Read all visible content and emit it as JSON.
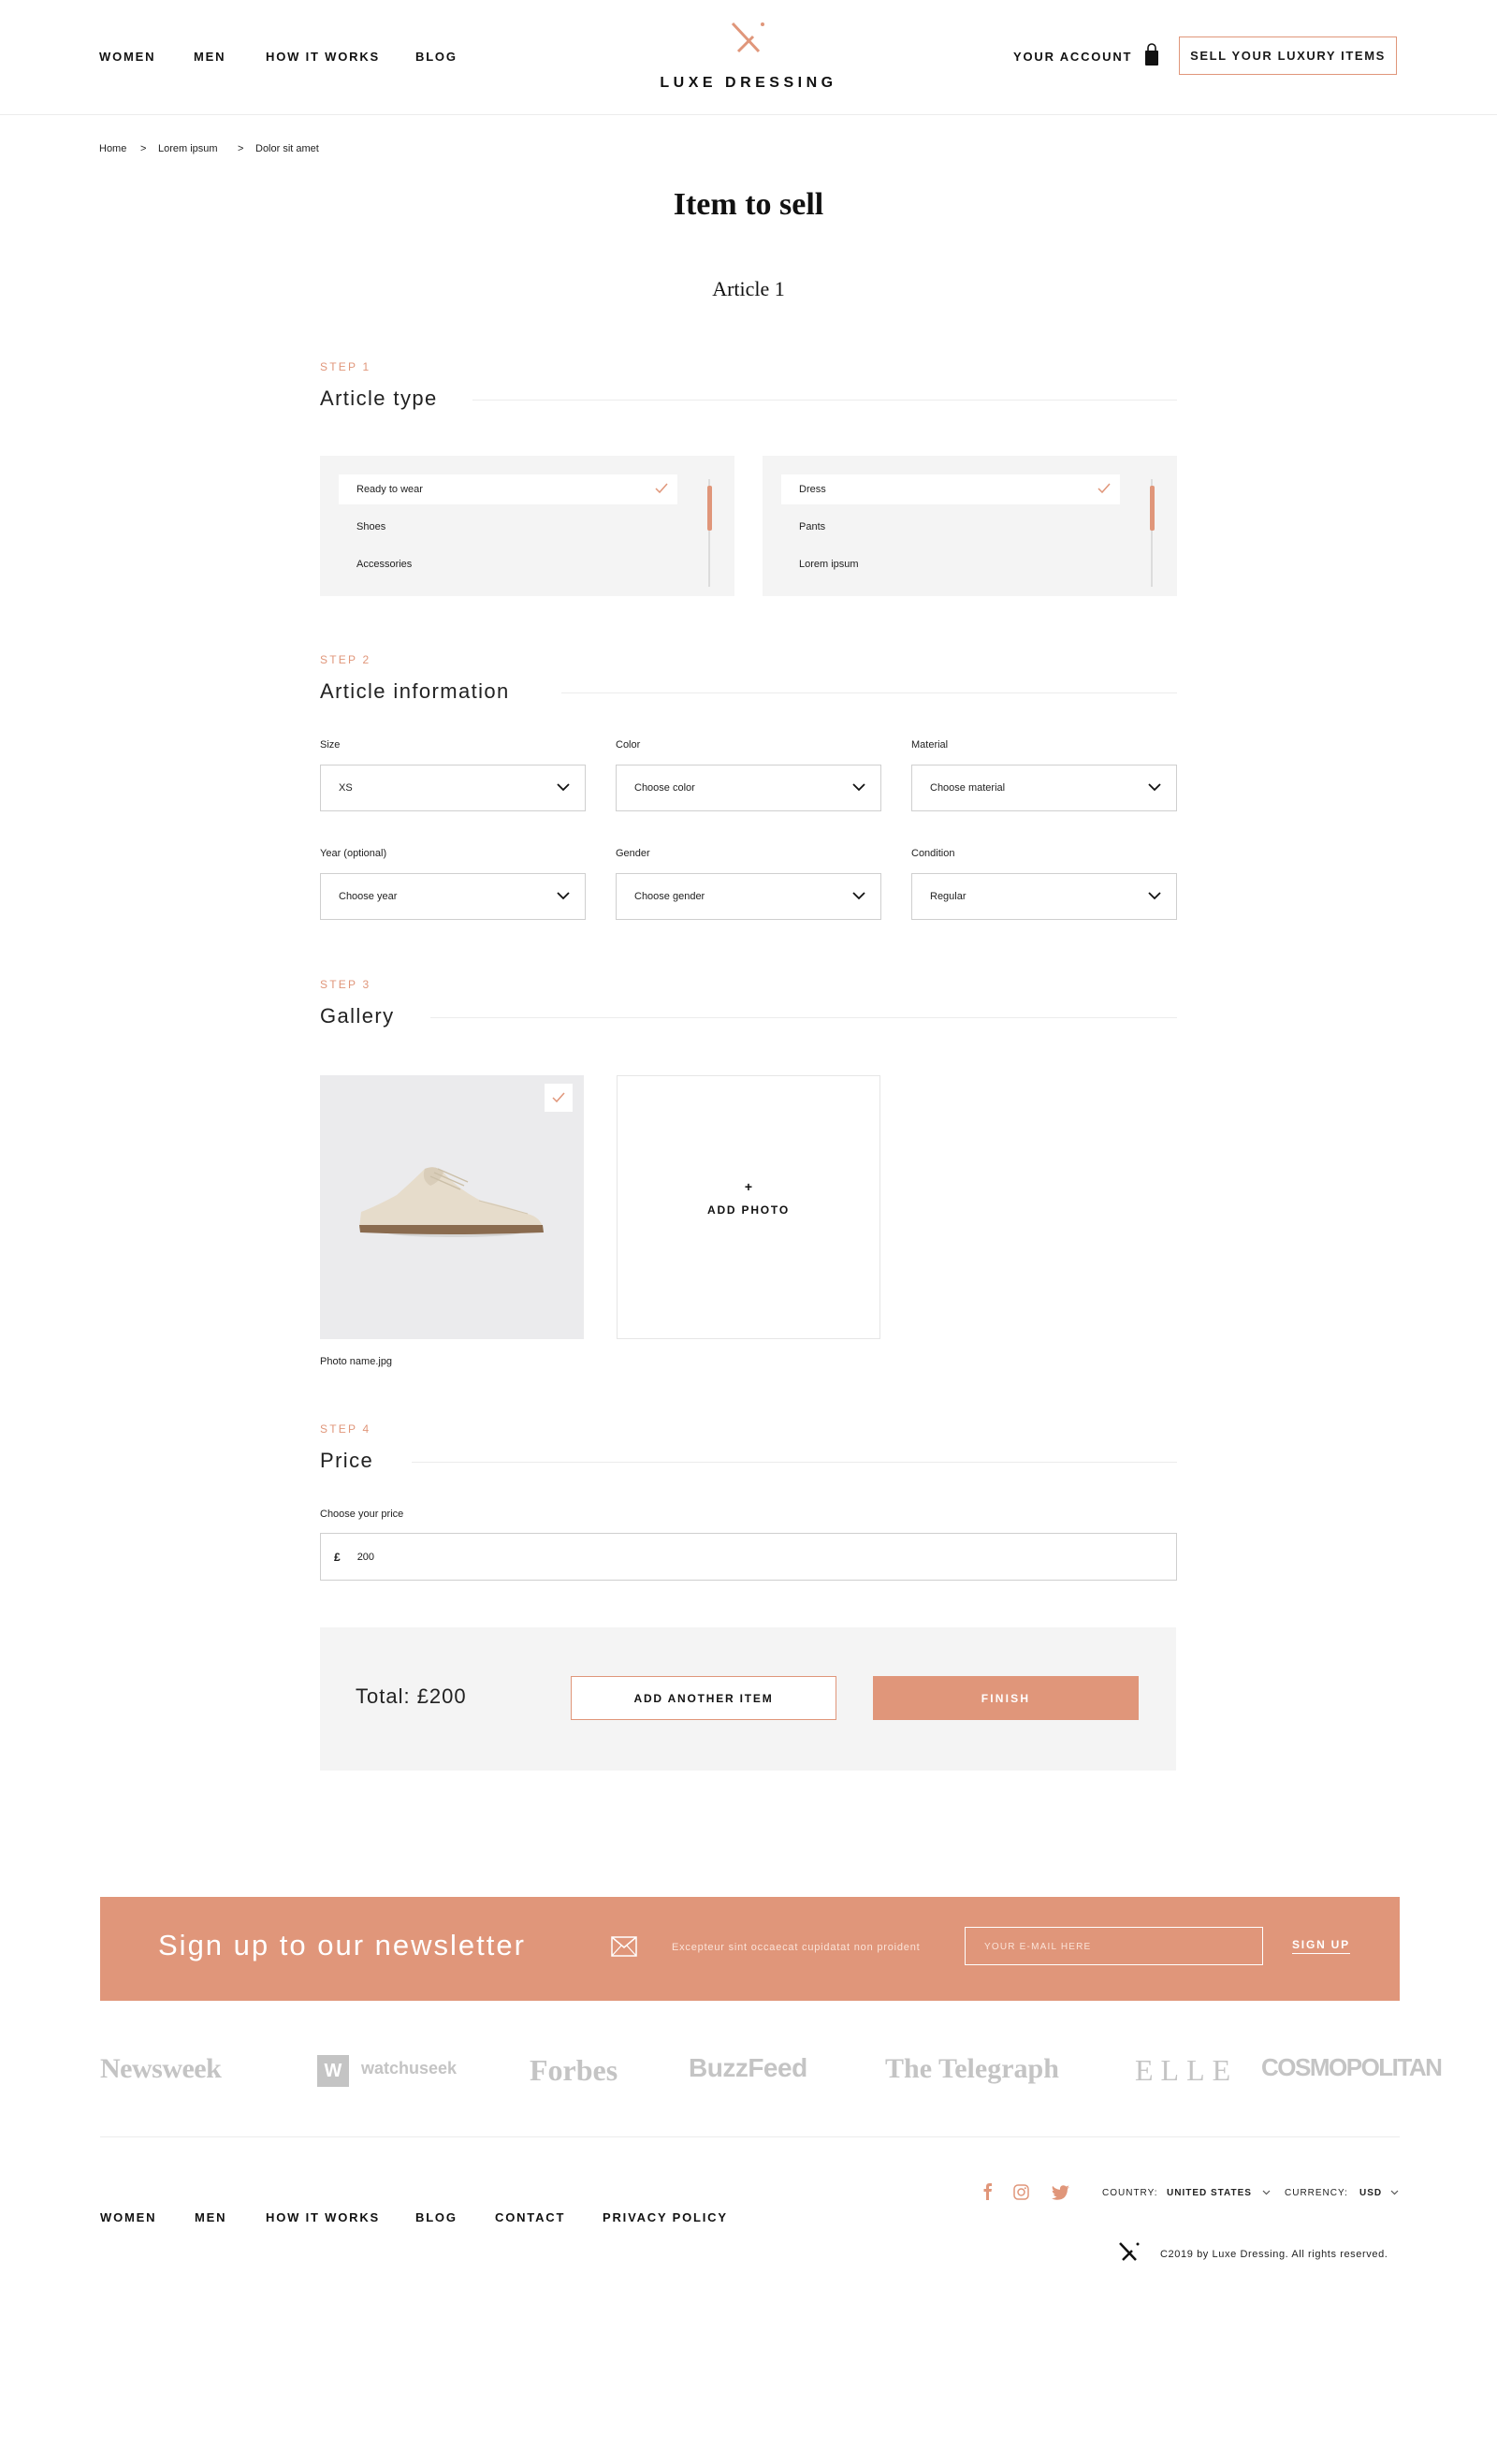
{
  "header": {
    "nav": [
      "WOMEN",
      "MEN",
      "HOW IT WORKS",
      "BLOG"
    ],
    "brand": "LUXE DRESSING",
    "account": "YOUR ACCOUNT",
    "sell_button": "SELL YOUR LUXURY ITEMS",
    "icons": {
      "logo": "crossed-x-logo-icon",
      "bag": "shopping-bag-icon"
    }
  },
  "breadcrumb": [
    "Home",
    "Lorem ipsum",
    "Dolor sit amet"
  ],
  "breadcrumb_sep": ">",
  "page_title": "Item to sell",
  "article_title": "Article 1",
  "colors": {
    "accent": "#e0967a",
    "panel": "#f4f4f4",
    "border": "#cfcfcf"
  },
  "step1": {
    "label": "STEP 1",
    "title": "Article type",
    "list_left": [
      "Ready to wear",
      "Shoes",
      "Accessories"
    ],
    "list_left_selected": "Ready to wear",
    "list_right": [
      "Dress",
      "Pants",
      "Lorem ipsum"
    ],
    "list_right_selected": "Dress"
  },
  "step2": {
    "label": "STEP 2",
    "title": "Article information",
    "fields": [
      {
        "label": "Size",
        "value": "XS"
      },
      {
        "label": "Color",
        "value": "Choose color"
      },
      {
        "label": "Material",
        "value": "Choose material"
      },
      {
        "label": "Year (optional)",
        "value": "Choose year"
      },
      {
        "label": "Gender",
        "value": "Choose gender"
      },
      {
        "label": "Condition",
        "value": "Regular"
      }
    ]
  },
  "step3": {
    "label": "STEP 3",
    "title": "Gallery",
    "photo_name": "Photo name.jpg",
    "add_plus": "+",
    "add_label": "ADD PHOTO"
  },
  "step4": {
    "label": "STEP 4",
    "title": "Price",
    "price_label": "Choose your price",
    "currency_symbol": "£",
    "price_value": "200"
  },
  "summary": {
    "total": "Total: £200",
    "add_another": "ADD ANOTHER ITEM",
    "finish": "FINISH"
  },
  "newsletter": {
    "title": "Sign up to our newsletter",
    "text": "Excepteur sint occaecat cupidatat non proident",
    "placeholder": "YOUR E-MAIL HERE",
    "button": "SIGN UP"
  },
  "press": [
    "Newsweek",
    "watchuseek",
    "Forbes",
    "BuzzFeed",
    "The Telegraph",
    "ELLE",
    "COSMOPOLITAN"
  ],
  "press_badge": "W",
  "footer": {
    "links": [
      "WOMEN",
      "MEN",
      "HOW IT WORKS",
      "BLOG",
      "CONTACT",
      "PRIVACY POLICY"
    ],
    "country_label": "COUNTRY:",
    "country_value": "UNITED STATES",
    "currency_label": "CURRENCY:",
    "currency_value": "USD",
    "copyright": "C2019 by Luxe Dressing. All rights reserved.",
    "social_icons": [
      "facebook-icon",
      "instagram-icon",
      "twitter-icon"
    ]
  }
}
